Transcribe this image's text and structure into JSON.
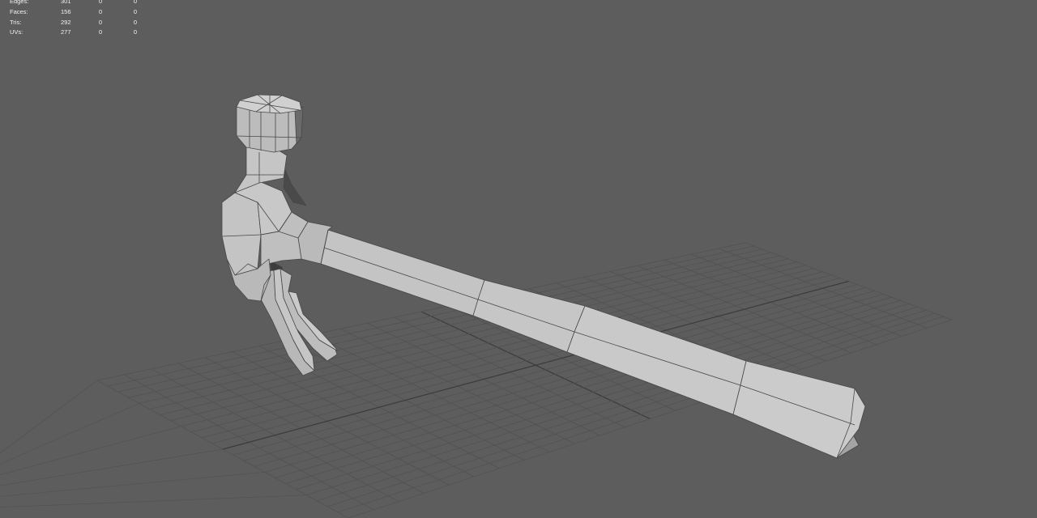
{
  "heads_up_display": {
    "rows": [
      {
        "label": "Edges:",
        "total": "301",
        "selected": "0",
        "component": "0"
      },
      {
        "label": "Faces:",
        "total": "156",
        "selected": "0",
        "component": "0"
      },
      {
        "label": "Tris:",
        "total": "292",
        "selected": "0",
        "component": "0"
      },
      {
        "label": "UVs:",
        "total": "277",
        "selected": "0",
        "component": "0"
      }
    ]
  },
  "colors": {
    "viewport_background": "#5d5d5d",
    "grid_line": "#525252",
    "grid_axis": "#3b3b3b",
    "mesh_light": "#c8c8c8",
    "mesh_mid": "#b6b6b6",
    "mesh_dark": "#9a9a9a",
    "mesh_shadow": "#3c3c3c",
    "wireframe": "#474747",
    "hud_text": "#f2f2f2"
  }
}
